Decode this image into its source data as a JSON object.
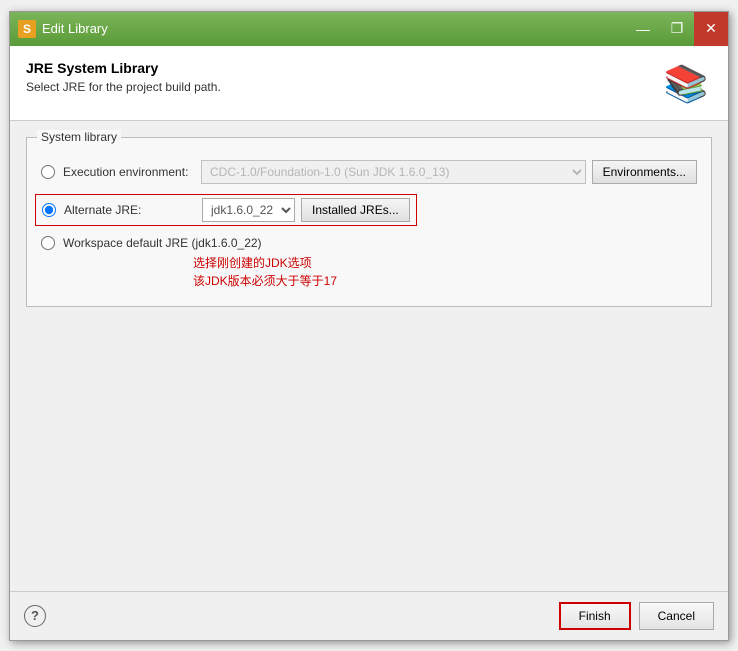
{
  "window": {
    "title": "Edit Library",
    "icon_label": "S"
  },
  "title_controls": {
    "minimize": "—",
    "maximize": "❐",
    "close": "✕"
  },
  "header": {
    "title": "JRE System Library",
    "subtitle": "Select JRE for the project build path.",
    "icon": "📚"
  },
  "group": {
    "label": "System library",
    "options": [
      {
        "id": "exec-env",
        "label": "Execution environment:",
        "selected": false,
        "value": "CDC-1.0/Foundation-1.0 (Sun JDK 1.6.0_13)",
        "button": "Environments..."
      },
      {
        "id": "alt-jre",
        "label": "Alternate JRE:",
        "selected": true,
        "value": "jdk1.6.0_22",
        "button": "Installed JREs..."
      },
      {
        "id": "ws-default",
        "label": "Workspace default JRE (jdk1.6.0_22)",
        "selected": false
      }
    ]
  },
  "annotation": {
    "line1": "选择刚创建的JDK选项",
    "line2": "该JDK版本必须大于等于17"
  },
  "footer": {
    "help_label": "?",
    "finish_label": "Finish",
    "cancel_label": "Cancel"
  }
}
